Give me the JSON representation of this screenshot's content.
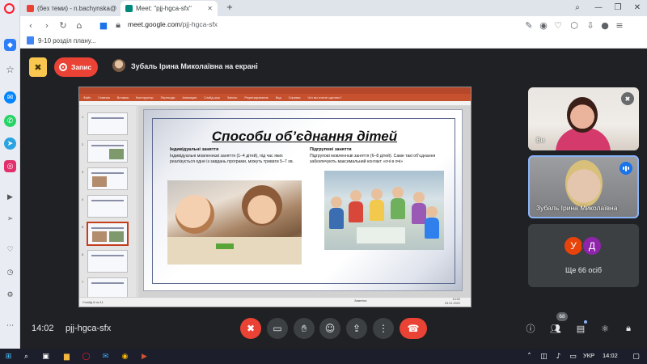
{
  "browser": {
    "tabs": [
      {
        "label": "(без теми) - n.bachynska@",
        "active": false
      },
      {
        "label": "Meet: \"pjj-hgca-sfx\"",
        "active": true
      }
    ],
    "new_tab": "+",
    "url_domain": "meet.google.com",
    "url_path": "/pjj-hgca-sfx",
    "bookmark": "9-10 розділ плану..."
  },
  "meet": {
    "record_label": "Запис",
    "presenting_label": "Зубаль Ірина Миколаївна на екрані",
    "time": "14:02",
    "meeting_code": "pjj-hgca-sfx",
    "people_count": "68",
    "tiles": {
      "you_label": "Ви",
      "presenter_label": "Зубаль Ірина Миколаївна",
      "others_avatars": [
        {
          "letter": "У",
          "color": "#e8430b"
        },
        {
          "letter": "Д",
          "color": "#8e24aa"
        }
      ],
      "others_count": "Ще 66 осіб"
    }
  },
  "powerpoint": {
    "ribbon_tabs": [
      "Файл",
      "Главная",
      "Вставка",
      "Конструктор",
      "Переходы",
      "Анимация",
      "Слайд-шоу",
      "Запись",
      "Рецензирование",
      "Вид",
      "Справка",
      "Что вы хотите сделать?"
    ],
    "thumb_numbers": [
      "1",
      "2",
      "3",
      "4",
      "5",
      "6",
      "7"
    ],
    "status_left": "Слайд 6 из 11",
    "zoom": "Заметки",
    "clock_time": "14:02",
    "clock_date": "03.01.2022"
  },
  "slide": {
    "title": "Способи об’єднання дітей",
    "individual_heading": "Індивідуальні заняття",
    "individual_text": "Індивідуальні мовленнєві заняття (1–4 дітей), під час яких реалізується одне із завдань програми, можуть тривати 5–7 хв.",
    "group_heading": "Підгрупові заняття",
    "group_text": "Підгрупові мовленнєві заняття (6–8 дітей). Саме такі об’єднання забезпечують максимальний контакт «очі в очі»"
  },
  "taskbar": {
    "language": "УКР",
    "clock": "14:02"
  },
  "colors": {
    "meet_bg": "#202124",
    "record_red": "#ea4335",
    "powerpoint_orange": "#c6512f",
    "accent_blue": "#1a73e8"
  }
}
